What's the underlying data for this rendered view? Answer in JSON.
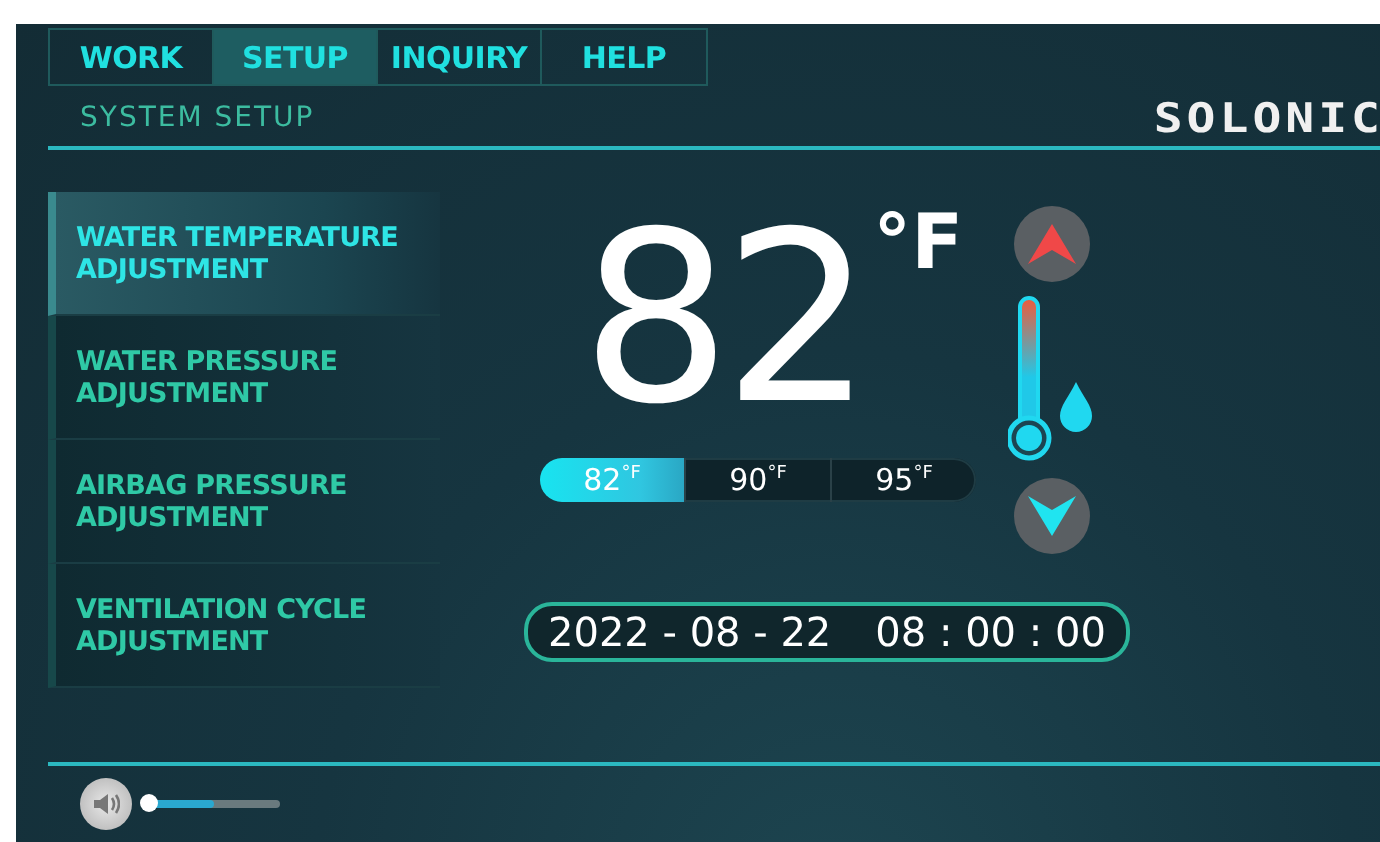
{
  "tabs": [
    {
      "label": "WORK",
      "selected": false
    },
    {
      "label": "SETUP",
      "selected": true
    },
    {
      "label": "INQUIRY",
      "selected": false
    },
    {
      "label": "HELP",
      "selected": false
    }
  ],
  "subtitle": "SYSTEM SETUP",
  "logo": "SOLONIC",
  "sidebar": {
    "items": [
      {
        "label": "WATER TEMPERATURE ADJUSTMENT",
        "selected": true
      },
      {
        "label": "WATER PRESSURE ADJUSTMENT",
        "selected": false
      },
      {
        "label": "AIRBAG PRESSURE ADJUSTMENT",
        "selected": false
      },
      {
        "label": "VENTILATION CYCLE ADJUSTMENT",
        "selected": false
      }
    ]
  },
  "temperature": {
    "value": "82",
    "unit": "°F"
  },
  "presets": [
    {
      "value": "82",
      "unit": "°F",
      "selected": true
    },
    {
      "value": "90",
      "unit": "°F",
      "selected": false
    },
    {
      "value": "95",
      "unit": "°F",
      "selected": false
    }
  ],
  "datetime": {
    "date": "2022 - 08 - 22",
    "time": "08 : 00 : 00"
  },
  "volume": {
    "level": 0.5
  }
}
